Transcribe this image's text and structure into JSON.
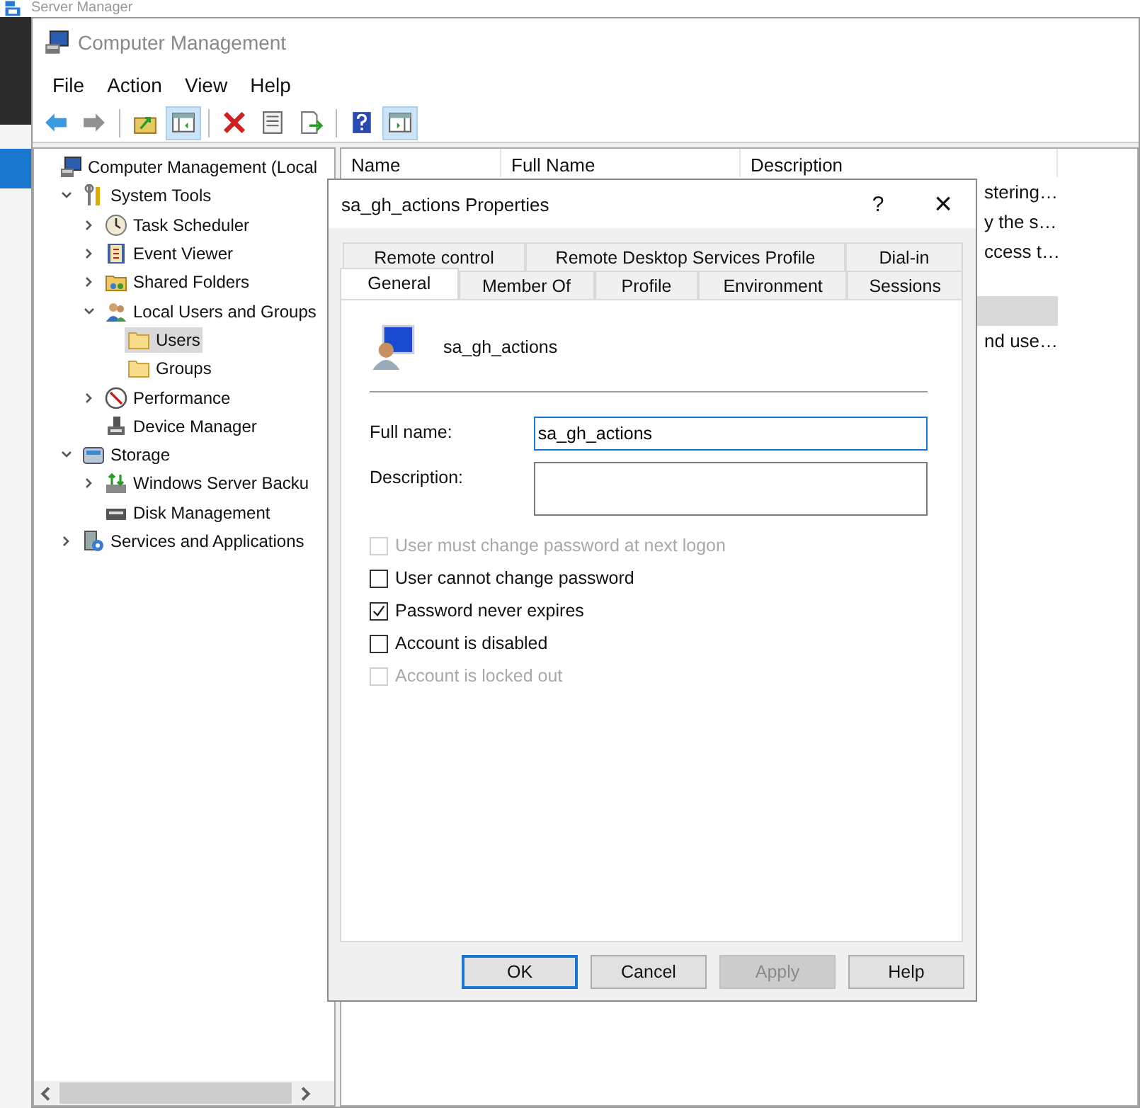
{
  "background_window": {
    "title": "Server Manager"
  },
  "window": {
    "title": "Computer Management"
  },
  "menu": [
    "File",
    "Action",
    "View",
    "Help"
  ],
  "toolbar": [
    {
      "kind": "back",
      "pressed": false
    },
    {
      "kind": "forward",
      "pressed": false
    },
    {
      "kind": "up",
      "pressed": false
    },
    {
      "kind": "tree",
      "pressed": true
    },
    {
      "kind": "delete",
      "pressed": false
    },
    {
      "kind": "properties",
      "pressed": false
    },
    {
      "kind": "export",
      "pressed": false
    },
    {
      "kind": "help",
      "pressed": false
    },
    {
      "kind": "actions",
      "pressed": true
    }
  ],
  "tree": [
    {
      "label": "Computer Management (Local",
      "kind": "computer",
      "selected": false,
      "children": [
        {
          "label": "System Tools",
          "kind": "tools",
          "expanded": true,
          "selected": false,
          "children": [
            {
              "label": "Task Scheduler",
              "kind": "clock",
              "expanded": false,
              "selected": false
            },
            {
              "label": "Event Viewer",
              "kind": "log",
              "expanded": false,
              "selected": false
            },
            {
              "label": "Shared Folders",
              "kind": "share",
              "expanded": false,
              "selected": false
            },
            {
              "label": "Local Users and Groups",
              "kind": "users",
              "expanded": true,
              "selected": false,
              "children": [
                {
                  "label": "Users",
                  "kind": "folder",
                  "selected": true
                },
                {
                  "label": "Groups",
                  "kind": "folder",
                  "selected": false
                }
              ]
            },
            {
              "label": "Performance",
              "kind": "gauge",
              "expanded": false,
              "selected": false
            },
            {
              "label": "Device Manager",
              "kind": "device",
              "selected": false
            }
          ]
        },
        {
          "label": "Storage",
          "kind": "storage",
          "expanded": true,
          "selected": false,
          "children": [
            {
              "label": "Windows Server Backu",
              "kind": "backup",
              "expanded": false,
              "selected": false
            },
            {
              "label": "Disk Management",
              "kind": "disk",
              "selected": false
            }
          ]
        },
        {
          "label": "Services and Applications",
          "kind": "services",
          "expanded": false,
          "selected": false
        }
      ]
    }
  ],
  "list": {
    "columns": [
      "Name",
      "Full Name",
      "Description"
    ],
    "rows": [
      {
        "description": "stering…",
        "selected": false
      },
      {
        "description": "y the s…",
        "selected": false
      },
      {
        "description": "ccess t…",
        "selected": false
      },
      {
        "selected": false
      },
      {
        "selected": true
      },
      {
        "description": "nd use…",
        "selected": false
      }
    ]
  },
  "dialog": {
    "title": "sa_gh_actions Properties",
    "help_button": "?",
    "close_button": "×",
    "tab_rows": [
      [
        {
          "label": "Remote control",
          "selected": false
        },
        {
          "label": "Remote Desktop Services Profile",
          "selected": false
        },
        {
          "label": "Dial-in",
          "selected": false
        }
      ],
      [
        {
          "label": "General",
          "selected": true
        },
        {
          "label": "Member Of",
          "selected": false
        },
        {
          "label": "Profile",
          "selected": false
        },
        {
          "label": "Environment",
          "selected": false
        },
        {
          "label": "Sessions",
          "selected": false
        }
      ]
    ],
    "user_name": "sa_gh_actions",
    "fields": [
      {
        "label": "Full name:",
        "value": "sa_gh_actions",
        "focused": true,
        "multiline": false
      },
      {
        "label": "Description:",
        "focused": false,
        "multiline": true
      }
    ],
    "checkboxes": [
      {
        "label": "User must change password at next logon",
        "checked": false,
        "disabled": true
      },
      {
        "label": "User cannot change password",
        "checked": false,
        "disabled": false
      },
      {
        "label": "Password never expires",
        "checked": true,
        "disabled": false
      },
      {
        "label": "Account is disabled",
        "checked": false,
        "disabled": false
      },
      {
        "label": "Account is locked out",
        "checked": false,
        "disabled": true
      }
    ],
    "buttons": [
      {
        "label": "OK",
        "default": true,
        "disabled": false
      },
      {
        "label": "Cancel",
        "default": false,
        "disabled": false
      },
      {
        "label": "Apply",
        "default": false,
        "disabled": true
      },
      {
        "label": "Help",
        "default": false,
        "disabled": false
      }
    ]
  }
}
